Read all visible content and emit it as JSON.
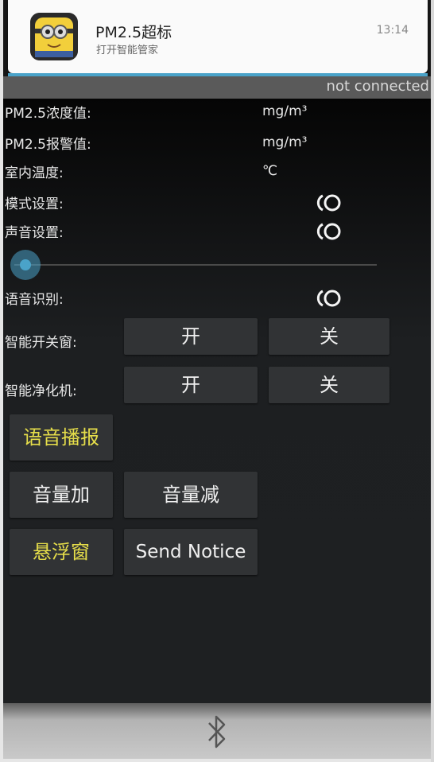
{
  "notification": {
    "title": "PM2.5超标",
    "text": "打开智能管家",
    "time": "13:14",
    "icon": "minion-app-icon"
  },
  "status": {
    "connection": "not connected"
  },
  "readings": {
    "pm25_value_label": "PM2.5浓度值:",
    "pm25_value_unit": "mg/m³",
    "pm25_alarm_label": "PM2.5报警值:",
    "pm25_alarm_unit": "mg/m³",
    "temp_label": "室内温度:",
    "temp_unit": "℃"
  },
  "settings": {
    "mode_label": "模式设置:",
    "sound_label": "声音设置:",
    "voice_recognition_label": "语音识别:",
    "toggle_icon": "toggle-radio-icon"
  },
  "slider": {
    "level": 0.0
  },
  "window_control": {
    "label": "智能开关窗:",
    "on": "开",
    "off": "关"
  },
  "purifier_control": {
    "label": "智能净化机:",
    "on": "开",
    "off": "关"
  },
  "buttons": {
    "voice_broadcast": "语音播报",
    "volume_up": "音量加",
    "volume_down": "音量减",
    "floating_window": "悬浮窗",
    "send_notice": "Send Notice"
  },
  "colors": {
    "accent_blue": "#4aa3c9",
    "yellow_text": "#e6de4a",
    "button_bg": "#313335"
  },
  "bottom": {
    "icon": "bluetooth-icon"
  }
}
